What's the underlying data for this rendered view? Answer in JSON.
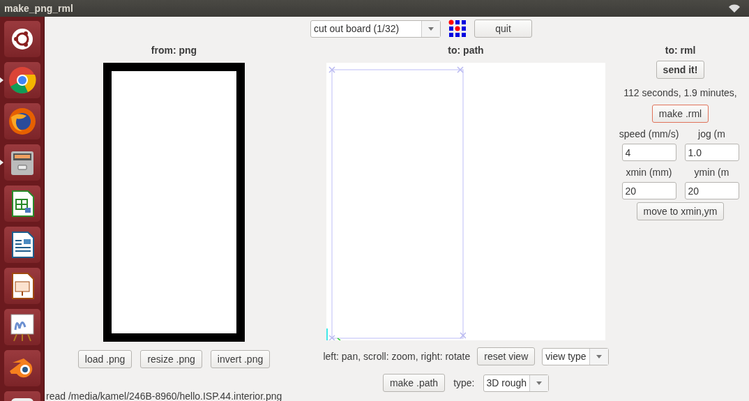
{
  "window": {
    "title": "make_png_rml"
  },
  "launcher": {
    "items": [
      {
        "kind": "ubuntu",
        "running": false
      },
      {
        "kind": "chrome",
        "running": true
      },
      {
        "kind": "firefox",
        "running": false
      },
      {
        "kind": "files",
        "running": true
      },
      {
        "kind": "spreadsheet",
        "running": false
      },
      {
        "kind": "document",
        "running": false
      },
      {
        "kind": "presentation",
        "running": false
      },
      {
        "kind": "paint",
        "running": false
      },
      {
        "kind": "blender",
        "running": false
      },
      {
        "kind": "generic"
      }
    ]
  },
  "toolbar": {
    "mode_dropdown": {
      "value": "cut out board (1/32)"
    },
    "quit_button": "quit"
  },
  "png_panel": {
    "heading": "from: png",
    "buttons": [
      "load .png",
      "resize .png",
      "invert .png"
    ]
  },
  "path_panel": {
    "heading": "to: path",
    "hint": "left: pan, scroll: zoom, right: rotate",
    "reset_button": "reset view",
    "view_dropdown": {
      "value": "view type"
    },
    "make_button": "make .path",
    "type_label": "type:",
    "type_dropdown": {
      "value": "3D rough"
    }
  },
  "rml_panel": {
    "heading": "to: rml",
    "send_button": "send it!",
    "estimate": "112 seconds, 1.9 minutes,",
    "make_button": {
      "label": "make .rml",
      "focused": true
    },
    "fields": [
      {
        "label": "speed (mm/s)",
        "value": "4"
      },
      {
        "label": "jog (m",
        "value": "1.0"
      },
      {
        "label": "xmin (mm)",
        "value": "20"
      },
      {
        "label": "ymin (m",
        "value": "20"
      }
    ],
    "move_button": "move to xmin,ym"
  },
  "status_bar": {
    "text": "read /media/kamel/246B-8960/hello.ISP.44.interior.png"
  }
}
